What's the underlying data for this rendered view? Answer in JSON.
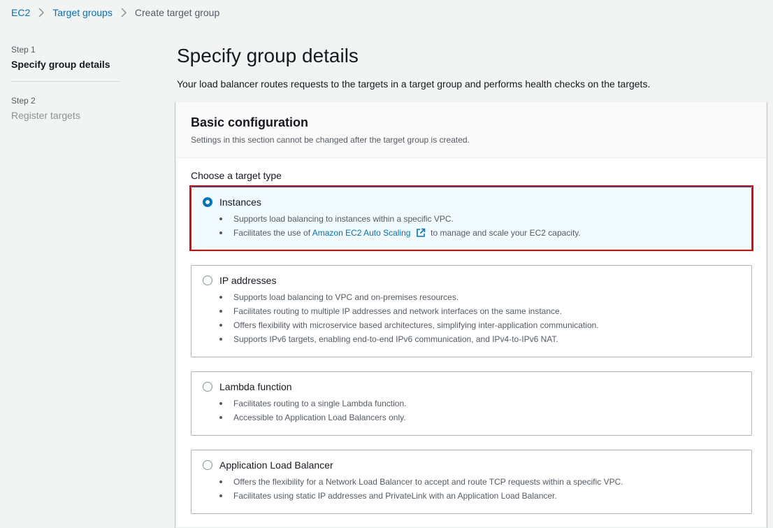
{
  "breadcrumb": {
    "items": [
      {
        "label": "EC2"
      },
      {
        "label": "Target groups"
      }
    ],
    "current": "Create target group"
  },
  "steps": [
    {
      "step": "Step 1",
      "title": "Specify group details",
      "active": true
    },
    {
      "step": "Step 2",
      "title": "Register targets",
      "active": false
    }
  ],
  "page": {
    "title": "Specify group details",
    "description": "Your load balancer routes requests to the targets in a target group and performs health checks on the targets."
  },
  "basic_config": {
    "title": "Basic configuration",
    "subtitle": "Settings in this section cannot be changed after the target group is created.",
    "choose_label": "Choose a target type",
    "options": [
      {
        "title": "Instances",
        "selected": true,
        "bullets": [
          "Supports load balancing to instances within a specific VPC."
        ],
        "bullet_with_link": {
          "before": "Facilitates the use of",
          "link": "Amazon EC2 Auto Scaling",
          "after": "to manage and scale your EC2 capacity."
        }
      },
      {
        "title": "IP addresses",
        "selected": false,
        "bullets": [
          "Supports load balancing to VPC and on-premises resources.",
          "Facilitates routing to multiple IP addresses and network interfaces on the same instance.",
          "Offers flexibility with microservice based architectures, simplifying inter-application communication.",
          "Supports IPv6 targets, enabling end-to-end IPv6 communication, and IPv4-to-IPv6 NAT."
        ]
      },
      {
        "title": "Lambda function",
        "selected": false,
        "bullets": [
          "Facilitates routing to a single Lambda function.",
          "Accessible to Application Load Balancers only."
        ]
      },
      {
        "title": "Application Load Balancer",
        "selected": false,
        "bullets": [
          "Offers the flexibility for a Network Load Balancer to accept and route TCP requests within a specific VPC.",
          "Facilitates using static IP addresses and PrivateLink with an Application Load Balancer."
        ]
      }
    ]
  },
  "colors": {
    "link": "#0073bb",
    "selected_bg": "#f1faff",
    "highlight": "#e60000"
  },
  "icons": {
    "separator": "chevron-right-icon",
    "external": "external-link-icon"
  }
}
